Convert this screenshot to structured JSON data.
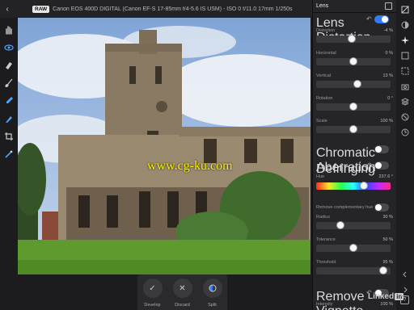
{
  "topbar": {
    "back_symbol": "‹",
    "raw_badge": "RAW",
    "camera_info": "Canon EOS 400D DIGITAL (Canon EF-S 17-85mm f/4-5.6 IS USM) - ISO 0 f/11.0 17mm 1/250s"
  },
  "tools": [
    "hand-icon",
    "eye-icon",
    "eraser-icon",
    "brush-icon",
    "eyedropper-icon",
    "fill-icon",
    "crop-icon",
    "wand-icon"
  ],
  "watermark": "www.cg-ku.com",
  "bottombar": {
    "develop_label": "Develop",
    "discard_label": "Discard",
    "split_label": "Split",
    "develop_glyph": "✓",
    "discard_glyph": "✕"
  },
  "panel": {
    "title": "Lens",
    "lens_distortion": {
      "title": "Lens Distortion",
      "enabled": true,
      "sliders": [
        {
          "label": "Distortion",
          "value": "-4 %",
          "fraction": 0.48
        },
        {
          "label": "Horizontal",
          "value": "0 %",
          "fraction": 0.5
        },
        {
          "label": "Vertical",
          "value": "13 %",
          "fraction": 0.56
        },
        {
          "label": "Rotation",
          "value": "0 °",
          "fraction": 0.5
        },
        {
          "label": "Scale",
          "value": "100 %",
          "fraction": 0.5
        }
      ]
    },
    "chromatic_aberration": {
      "title": "Chromatic Aberration",
      "enabled": false
    },
    "defringing": {
      "title": "Defringing",
      "enabled": false,
      "hue_label": "Hue",
      "hue_value": "237.6 °",
      "hue_fraction": 0.66,
      "remove_hue_label": "Remove complementary hue",
      "remove_hue_enabled": false,
      "sliders": [
        {
          "label": "Radius",
          "value": "30 %",
          "fraction": 0.3
        },
        {
          "label": "Tolerance",
          "value": "50 %",
          "fraction": 0.5
        },
        {
          "label": "Threshold",
          "value": "95 %",
          "fraction": 0.95
        }
      ]
    },
    "remove_vignette": {
      "title": "Remove Vignette",
      "enabled": false,
      "intensity_label": "Intensity",
      "intensity_value": "100 %"
    },
    "reset_symbol": "↶"
  },
  "strip_icons": [
    "panel-toggle-icon",
    "half-circle-icon",
    "light-icon",
    "square-icon",
    "frame-icon",
    "camera-icon",
    "layers-icon",
    "no-sign-icon",
    "clock-icon",
    "chevron-left-icon",
    "chevron-right-icon"
  ],
  "branding": {
    "linked": "Linked",
    "in": "in"
  },
  "help_label": "?"
}
